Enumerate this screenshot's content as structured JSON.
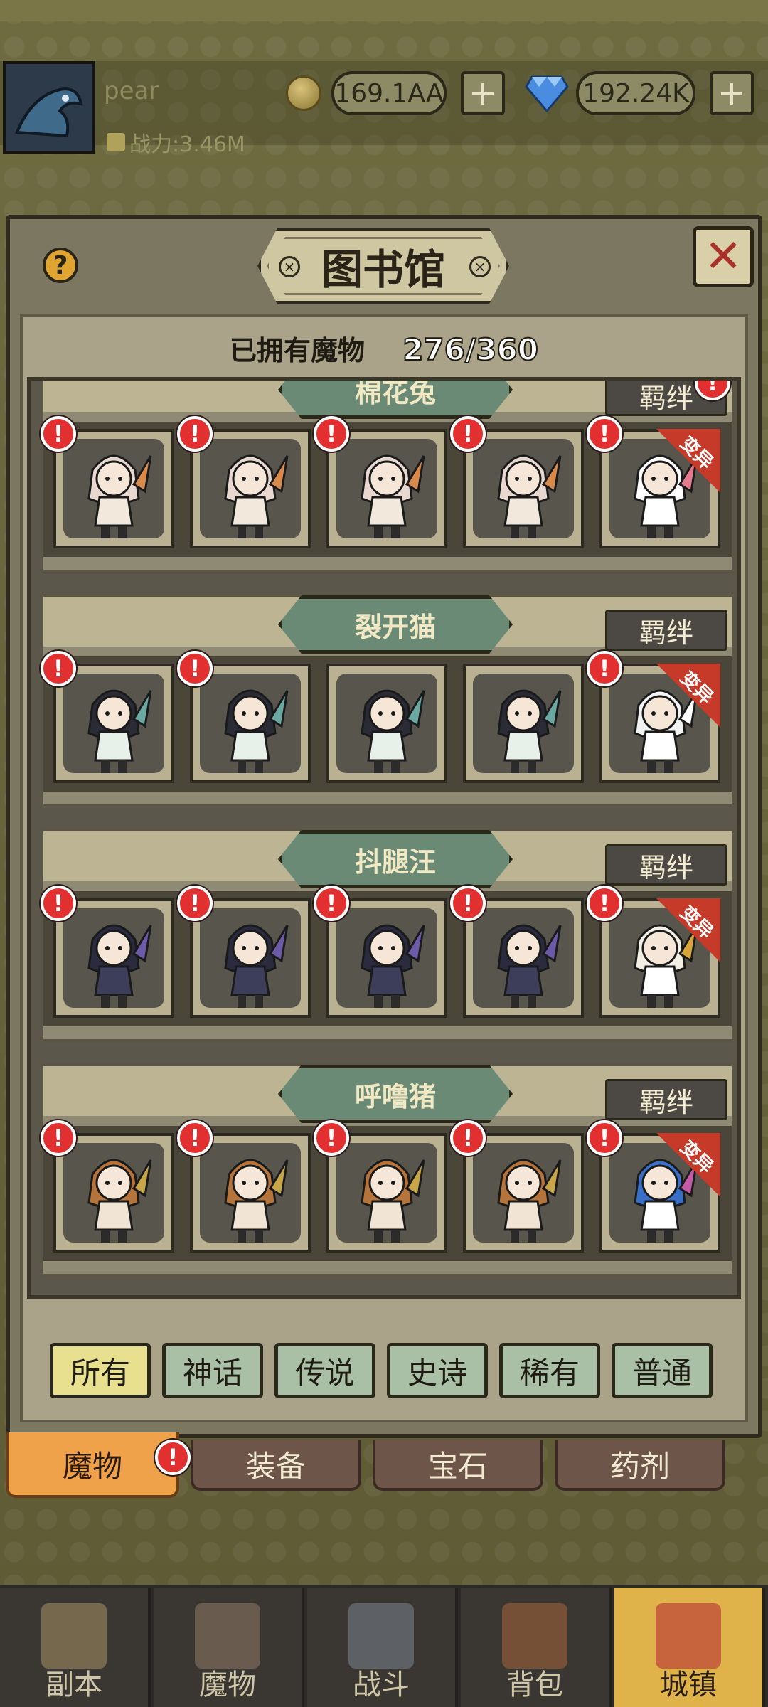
{
  "player": {
    "name": "pear",
    "power": "战力:3.46M",
    "coins": "169.1AA",
    "gems": "192.24K"
  },
  "library": {
    "title": "图书馆",
    "owned_label": "已拥有魔物",
    "owned_count": "276/360",
    "bond_label": "羁绊",
    "mutation_label": "变异",
    "groups": [
      {
        "name": "棉花兔",
        "body": "#f2e9dc",
        "hair": "#e8d8cf",
        "accent": "#d98a4a",
        "alt_hair": "#ffffff",
        "alt_accent": "#e47b8c"
      },
      {
        "name": "裂开猫",
        "body": "#e8f0ea",
        "hair": "#2b2b36",
        "accent": "#6aa9a0",
        "alt_hair": "#f2f2f2",
        "alt_accent": "#ffffff"
      },
      {
        "name": "抖腿汪",
        "body": "#3d3f5a",
        "hair": "#2a2b3f",
        "accent": "#6b5aa8",
        "alt_hair": "#f3efe4",
        "alt_accent": "#d9a43a"
      },
      {
        "name": "呼噜猪",
        "body": "#f1e4d4",
        "hair": "#b6733a",
        "accent": "#c9a54a",
        "alt_hair": "#3a6fc9",
        "alt_accent": "#c25aa6"
      }
    ]
  },
  "filters": [
    "所有",
    "神话",
    "传说",
    "史诗",
    "稀有",
    "普通"
  ],
  "categories": [
    "魔物",
    "装备",
    "宝石",
    "药剂"
  ],
  "bottom_nav": [
    "副本",
    "魔物",
    "战斗",
    "背包",
    "城镇"
  ],
  "colors": {
    "accent_alert": "#e22f2f",
    "active_tab": "#f0a24a",
    "active_filter": "#e9e08f",
    "active_nav": "#e0b24a"
  }
}
